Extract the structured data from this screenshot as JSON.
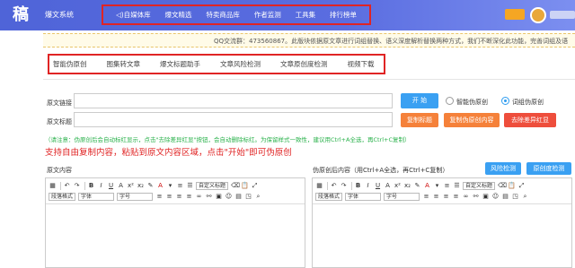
{
  "header": {
    "logo_glyph": "稿",
    "app_name": "爆文系统",
    "nav": [
      "自媒体库",
      "爆文精选",
      "特卖商品库",
      "作者监测",
      "工具集",
      "排行榜单"
    ],
    "nav_icon": "speaker-icon"
  },
  "notice": {
    "text": "QQ交流群：473560867。此版块依据原文章进行词组替换、语义深度解析替换两种方式，我们不断深化此功能，完善词组及语"
  },
  "tabs": [
    "智能伪原创",
    "图集转文章",
    "爆文标题助手",
    "文章风险检测",
    "文章原创度检测",
    "视频下载"
  ],
  "form": {
    "link_label": "原文链接",
    "title_label": "原文标题",
    "start_button": "开 始",
    "mode_options": [
      "智能伪原创",
      "词组伪原创"
    ],
    "mode_selected": 1,
    "copy_title_button": "复制标题",
    "copy_content_button": "复制伪原创内容",
    "remove_red_button": "去除差异红显",
    "hint": "（请注意：伪原创后会自动标红显示，点击\"去除差异红显\"按钮，会自动删除标红。为保留样式一致性，建议用Ctrl+A全选，再Ctrl+C复制）",
    "highlight": "支持自由复制内容，粘贴到原文内容区域，点击\"开始\"即可伪原创"
  },
  "editors": {
    "left_label": "原文内容",
    "right_label": "伪原创后内容（用Ctrl+A全选，再Ctrl+C复制）",
    "risk_button": "风险检测",
    "originality_button": "原创度检测",
    "toolbar_select_paragraph": "段落格式",
    "toolbar_select_font": "字体",
    "toolbar_select_size": "字号",
    "toolbar_select_custom": "自定义标题"
  },
  "colors": {
    "header_bg": "#5a6de0",
    "highlight_red": "#e02424",
    "hint_green": "#2bb24c",
    "button_blue": "#3aa0f2",
    "button_orange": "#f5813a",
    "button_red": "#ee4e3c"
  }
}
